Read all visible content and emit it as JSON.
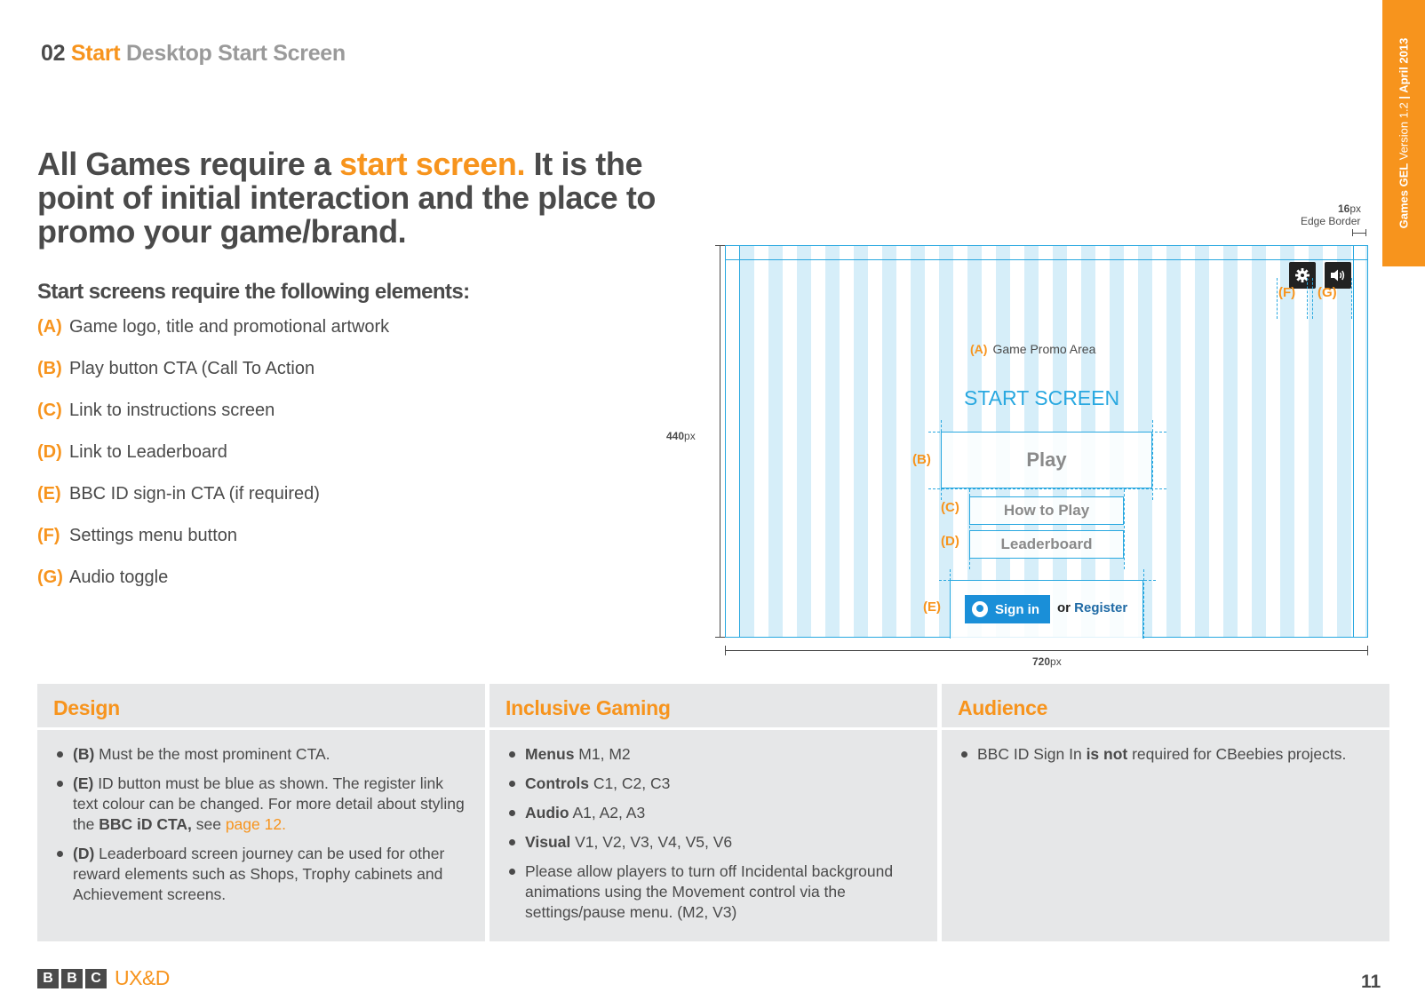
{
  "header": {
    "section_number": "02",
    "section_name": "Start",
    "page_title": "Desktop Start Screen"
  },
  "side_tab": {
    "doc_name": "Games GEL",
    "version": "Version 1.2",
    "separator": "|",
    "date": "April 2013"
  },
  "headline": {
    "part1": "All Games require a ",
    "highlight": "start screen.",
    "part2": " It is the point of initial interaction and the place to promo your game/brand."
  },
  "subhead": "Start screens require the following elements:",
  "elements": [
    {
      "key": "(A)",
      "text": "Game logo, title and promotional artwork"
    },
    {
      "key": "(B)",
      "text": "Play button CTA (Call To Action"
    },
    {
      "key": "(C)",
      "text": "Link to instructions screen"
    },
    {
      "key": "(D)",
      "text": "Link to Leaderboard"
    },
    {
      "key": "(E)",
      "text": "BBC ID sign-in CTA (if required)"
    },
    {
      "key": "(F)",
      "text": "Settings menu button"
    },
    {
      "key": "(G)",
      "text": "Audio toggle"
    }
  ],
  "wireframe": {
    "edge_value": "16",
    "edge_unit": "px",
    "edge_label": "Edge Border",
    "height_value": "440",
    "height_unit": "px",
    "width_value": "720",
    "width_unit": "px",
    "label_a": "(A)",
    "promo_area": "Game Promo Area",
    "title": "START SCREEN",
    "label_b": "(B)",
    "play": "Play",
    "label_c": "(C)",
    "how_to_play": "How to Play",
    "label_d": "(D)",
    "leaderboard": "Leaderboard",
    "label_e": "(E)",
    "sign_in": "Sign in",
    "or": "or ",
    "register": "Register",
    "label_f": "(F)",
    "label_g": "(G)",
    "settings_icon": "gear-icon",
    "audio_icon": "speaker-icon"
  },
  "panels": {
    "design": {
      "title": "Design",
      "b1_key": "(B)",
      "b1_text": " Must be the most prominent CTA.",
      "b2_key": "(E)",
      "b2_text": " ID button must be blue as shown. The register link text colour can be changed. For more detail about styling the ",
      "b2_bold": "BBC iD CTA,",
      "b2_see": " see ",
      "b2_link": "page 12.",
      "b3_key": "(D)",
      "b3_text": " Leaderboard screen journey can be used for other reward elements such as Shops, Trophy cabinets and Achievement screens."
    },
    "inclusive": {
      "title": "Inclusive Gaming",
      "items": [
        {
          "bold": "Menus",
          "text": " M1, M2"
        },
        {
          "bold": "Controls",
          "text": " C1, C2, C3"
        },
        {
          "bold": "Audio",
          "text": " A1, A2, A3"
        },
        {
          "bold": "Visual",
          "text": " V1, V2, V3, V4, V5, V6"
        }
      ],
      "last": "Please allow players to turn off Incidental background animations using the Movement control via the settings/pause menu. (M2, V3)"
    },
    "audience": {
      "title": "Audience",
      "b1_pre": "BBC ID Sign In ",
      "b1_bold": "is not",
      "b1_post": " required for CBeebies projects."
    }
  },
  "footer": {
    "logo_letters": [
      "B",
      "B",
      "C"
    ],
    "logo_suffix": "UX&D",
    "page_number": "11"
  },
  "colors": {
    "accent": "#f7941d",
    "guide_blue": "#29a8e0",
    "id_blue": "#1a8fd8",
    "text_dark": "#4a4a4a",
    "panel_bg": "#e6e7e8"
  }
}
